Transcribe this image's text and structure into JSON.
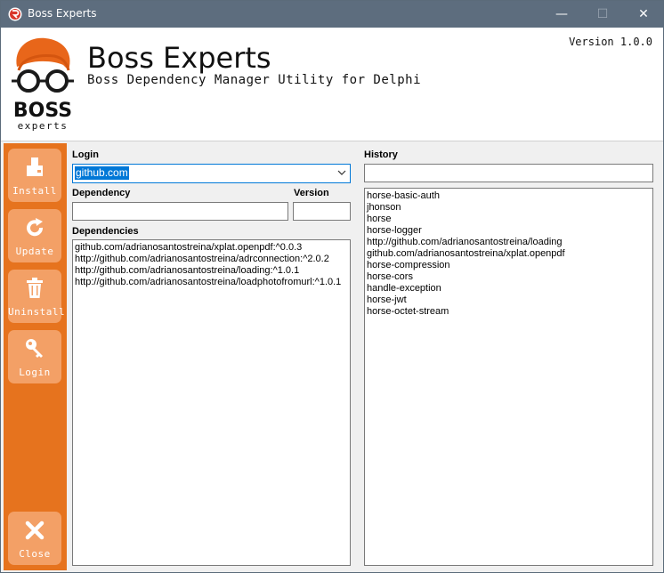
{
  "window": {
    "title": "Boss Experts",
    "minimize": "—",
    "maximize": "☐",
    "close": "✕"
  },
  "header": {
    "title": "Boss Experts",
    "subtitle": "Boss Dependency Manager Utility for Delphi",
    "version": "Version 1.0.0",
    "logo_text": "BOSS",
    "logo_subtext": "experts"
  },
  "sidebar": {
    "install": "Install",
    "update": "Update",
    "uninstall": "Uninstall",
    "login": "Login",
    "close": "Close"
  },
  "form": {
    "login_label": "Login",
    "login_value": "github.com",
    "dependency_label": "Dependency",
    "dependency_value": "",
    "version_label": "Version",
    "version_value": "",
    "dependencies_label": "Dependencies",
    "dependencies": [
      "github.com/adrianosantostreina/xplat.openpdf:^0.0.3",
      "http://github.com/adrianosantostreina/adrconnection:^2.0.2",
      "http://github.com/adrianosantostreina/loading:^1.0.1",
      "http://github.com/adrianosantostreina/loadphotofromurl:^1.0.1"
    ],
    "history_label": "History",
    "history_filter": "",
    "history": [
      "horse-basic-auth",
      "jhonson",
      "horse",
      "horse-logger",
      "http://github.com/adrianosantostreina/loading",
      "github.com/adrianosantostreina/xplat.openpdf",
      "horse-compression",
      "horse-cors",
      "handle-exception",
      "horse-jwt",
      "horse-octet-stream"
    ]
  },
  "colors": {
    "titlebar": "#5d6d7e",
    "sidebar": "#e6731e",
    "sidebar_button": "#f3a066",
    "selection": "#0078d7"
  }
}
